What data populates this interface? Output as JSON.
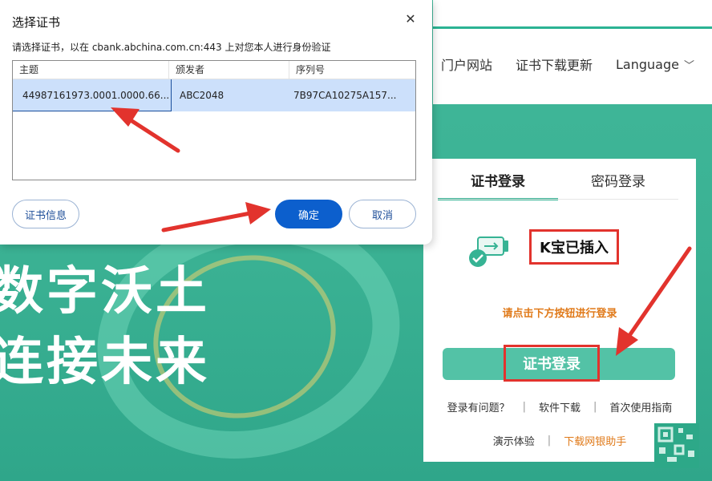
{
  "nav": {
    "items": [
      "门户网站",
      "证书下载更新",
      "Language"
    ]
  },
  "slogan": {
    "line1": "数字沃土",
    "line2": "连接未来"
  },
  "login": {
    "tabs": [
      "证书登录",
      "密码登录"
    ],
    "kbao_status": "K宝已插入",
    "hint": "请点击下方按钮进行登录",
    "login_button": "证书登录",
    "links_row1": [
      "登录有问题？",
      "软件下载",
      "首次使用指南"
    ],
    "links_row2": [
      "演示体验",
      "下载网银助手"
    ]
  },
  "dialog": {
    "title": "选择证书",
    "description": "请选择证书，以在 cbank.abchina.com.cn:443 上对您本人进行身份验证",
    "columns": [
      "主题",
      "颁发者",
      "序列号"
    ],
    "rows": [
      {
        "subject": "44987161973.0001.0000.66...",
        "issuer": "ABC2048",
        "serial": "7B97CA10275A157..."
      }
    ],
    "buttons": {
      "info": "证书信息",
      "ok": "确定",
      "cancel": "取消"
    }
  },
  "colors": {
    "brand_teal": "#3fb899",
    "primary_blue": "#0c5fcd",
    "annotation_red": "#e2332d",
    "hint_orange": "#e07a1a"
  }
}
